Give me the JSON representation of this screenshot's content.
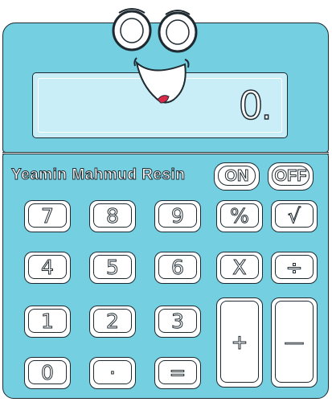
{
  "brand": {
    "text": "Yeamin Mahmud Resin"
  },
  "display": {
    "value": "0",
    "decimal_point": "."
  },
  "keys": {
    "on": "ON",
    "off": "OFF",
    "seven": "7",
    "eight": "8",
    "nine": "9",
    "percent": "%",
    "sqrt": "√",
    "four": "4",
    "five": "5",
    "six": "6",
    "multiply": "X",
    "divide": "÷",
    "one": "1",
    "two": "2",
    "three": "3",
    "plus": "+",
    "minus": "—",
    "zero": "0",
    "dot": "·",
    "equals": "="
  },
  "colors": {
    "body": "#74cfe1",
    "screen": "#c9eef7",
    "key": "#ffffff",
    "outline": "#1f2a30",
    "mouth": "#d9294a"
  }
}
